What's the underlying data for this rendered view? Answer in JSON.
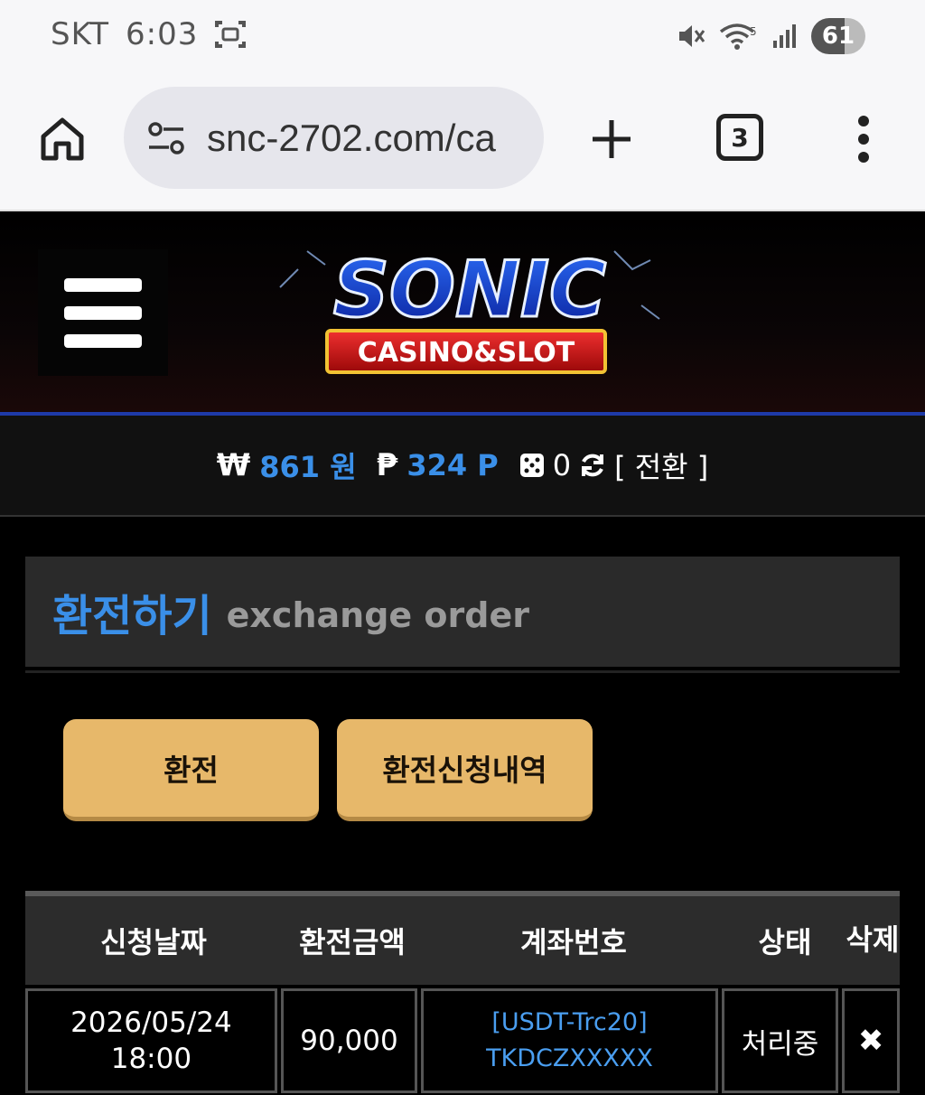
{
  "status_bar": {
    "carrier": "SKT",
    "time": "6:03",
    "battery": "61"
  },
  "browser": {
    "url": "snc-2702.com/ca",
    "tab_count": "3"
  },
  "header": {
    "logo_main": "SONIC",
    "logo_sub": "CASINO&SLOT"
  },
  "balance": {
    "won_symbol": "₩",
    "won_value": "861 원",
    "point_symbol": "₱",
    "point_value": "324 P",
    "dice_count": "0",
    "convert_label": "[ 전환 ]"
  },
  "page": {
    "title_ko": "환전하기",
    "title_en": "exchange order",
    "btn_exchange": "환전",
    "btn_history": "환전신청내역"
  },
  "table": {
    "headers": [
      "신청날짜",
      "환전금액",
      "계좌번호",
      "상태",
      "삭제"
    ],
    "rows": [
      {
        "date_line1": "2026/05/24",
        "date_line2": "18:00",
        "amount": "90,000",
        "account_line1": "[USDT-Trc20]",
        "account_line2": "TKDCZXXXXX",
        "status": "처리중",
        "delete": "✖"
      }
    ]
  },
  "colors": {
    "accent_blue": "#3a8fe8",
    "button_gold": "#e7b86a"
  }
}
